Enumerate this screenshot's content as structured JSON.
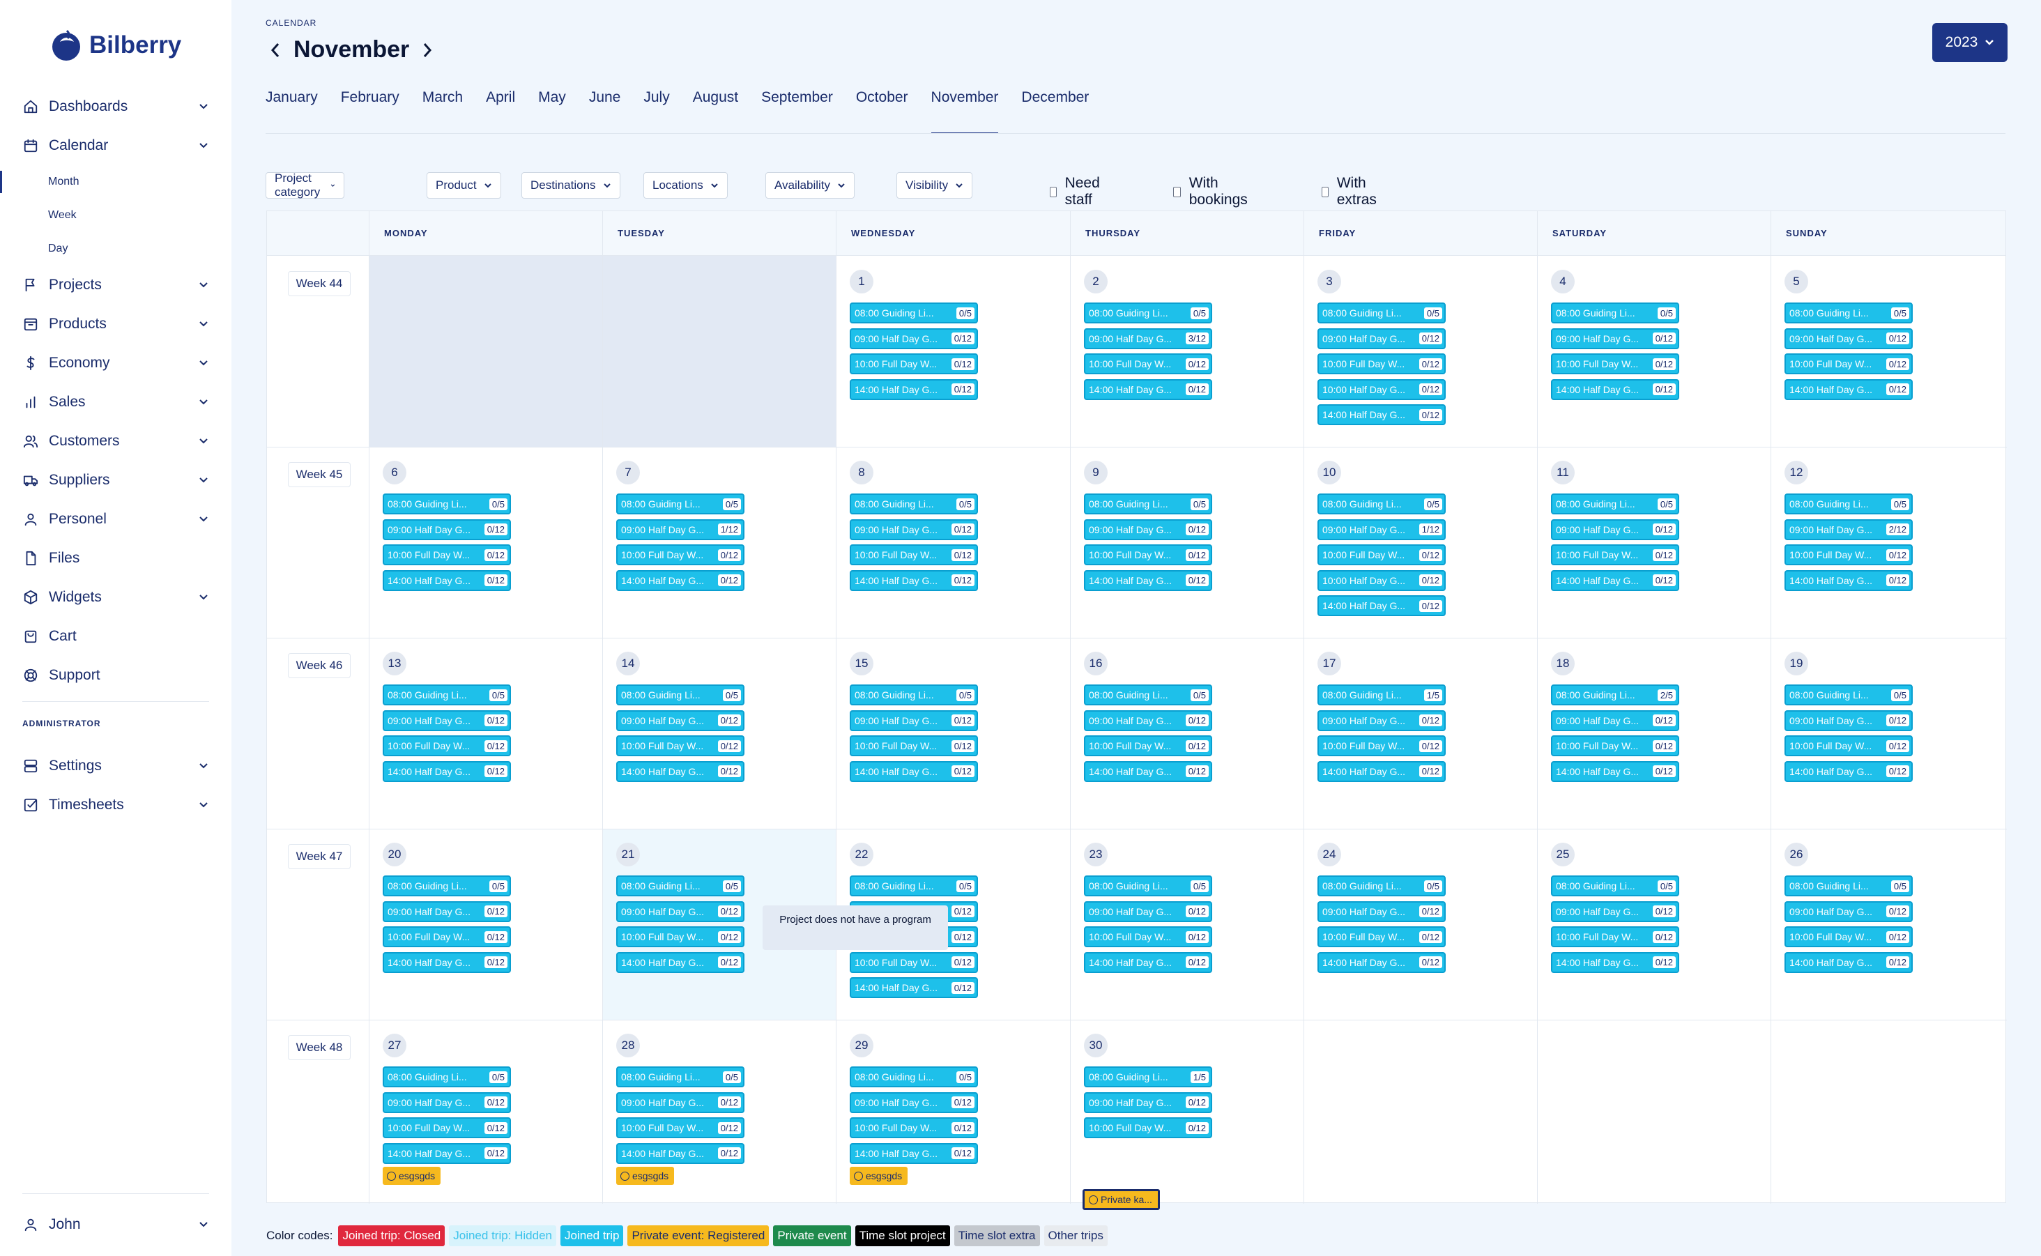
{
  "app": {
    "name": "Bilberry"
  },
  "sidebar": {
    "items": [
      {
        "label": "Dashboards",
        "icon": "home-icon",
        "chevron": true
      },
      {
        "label": "Calendar",
        "icon": "calendar-icon",
        "chevron": true
      },
      {
        "label": "Projects",
        "icon": "flag-icon",
        "chevron": true
      },
      {
        "label": "Products",
        "icon": "archive-icon",
        "chevron": true
      },
      {
        "label": "Economy",
        "icon": "dollar-icon",
        "chevron": true
      },
      {
        "label": "Sales",
        "icon": "bar-chart-icon",
        "chevron": true
      },
      {
        "label": "Customers",
        "icon": "users-icon",
        "chevron": true
      },
      {
        "label": "Suppliers",
        "icon": "truck-icon",
        "chevron": true
      },
      {
        "label": "Personel",
        "icon": "user-icon",
        "chevron": true
      },
      {
        "label": "Files",
        "icon": "file-icon",
        "chevron": false
      },
      {
        "label": "Widgets",
        "icon": "cube-icon",
        "chevron": true
      },
      {
        "label": "Cart",
        "icon": "cart-icon",
        "chevron": false
      },
      {
        "label": "Support",
        "icon": "lifebuoy-icon",
        "chevron": false
      }
    ],
    "calendar_sub": [
      "Month",
      "Week",
      "Day"
    ],
    "admin_label": "ADMINISTRATOR",
    "admin_items": [
      {
        "label": "Settings",
        "icon": "database-icon",
        "chevron": true
      },
      {
        "label": "Timesheets",
        "icon": "checkbox-icon",
        "chevron": true
      }
    ],
    "user": {
      "label": "John",
      "icon": "user-icon"
    }
  },
  "header": {
    "section_label": "CALENDAR",
    "title": "November",
    "year": "2023"
  },
  "months": [
    "January",
    "February",
    "March",
    "April",
    "May",
    "June",
    "July",
    "August",
    "September",
    "October",
    "November",
    "December"
  ],
  "active_month": "November",
  "filters": [
    "Project category",
    "Product",
    "Destinations",
    "Locations",
    "Availability",
    "Visibility"
  ],
  "checks": [
    "Need staff",
    "With bookings",
    "With extras"
  ],
  "weekdays": [
    "MONDAY",
    "TUESDAY",
    "WEDNESDAY",
    "THURSDAY",
    "FRIDAY",
    "SATURDAY",
    "SUNDAY"
  ],
  "weeks": [
    {
      "label": "Week 44",
      "days": [
        null,
        null,
        {
          "num": "1",
          "events": [
            [
              "08:00 Guiding Li...",
              "0/5"
            ],
            [
              "09:00 Half Day G...",
              "0/12"
            ],
            [
              "10:00 Full Day W...",
              "0/12"
            ],
            [
              "14:00 Half Day G...",
              "0/12"
            ]
          ]
        },
        {
          "num": "2",
          "events": [
            [
              "08:00 Guiding Li...",
              "0/5"
            ],
            [
              "09:00 Half Day G...",
              "3/12"
            ],
            [
              "10:00 Full Day W...",
              "0/12"
            ],
            [
              "14:00 Half Day G...",
              "0/12"
            ]
          ]
        },
        {
          "num": "3",
          "events": [
            [
              "08:00 Guiding Li...",
              "0/5"
            ],
            [
              "09:00 Half Day G...",
              "0/12"
            ],
            [
              "10:00 Full Day W...",
              "0/12"
            ],
            [
              "10:00 Half Day G...",
              "0/12"
            ],
            [
              "14:00 Half Day G...",
              "0/12"
            ]
          ]
        },
        {
          "num": "4",
          "events": [
            [
              "08:00 Guiding Li...",
              "0/5"
            ],
            [
              "09:00 Half Day G...",
              "0/12"
            ],
            [
              "10:00 Full Day W...",
              "0/12"
            ],
            [
              "14:00 Half Day G...",
              "0/12"
            ]
          ]
        },
        {
          "num": "5",
          "events": [
            [
              "08:00 Guiding Li...",
              "0/5"
            ],
            [
              "09:00 Half Day G...",
              "0/12"
            ],
            [
              "10:00 Full Day W...",
              "0/12"
            ],
            [
              "14:00 Half Day G...",
              "0/12"
            ]
          ]
        }
      ]
    },
    {
      "label": "Week 45",
      "days": [
        {
          "num": "6",
          "events": [
            [
              "08:00 Guiding Li...",
              "0/5"
            ],
            [
              "09:00 Half Day G...",
              "0/12"
            ],
            [
              "10:00 Full Day W...",
              "0/12"
            ],
            [
              "14:00 Half Day G...",
              "0/12"
            ]
          ]
        },
        {
          "num": "7",
          "events": [
            [
              "08:00 Guiding Li...",
              "0/5"
            ],
            [
              "09:00 Half Day G...",
              "1/12"
            ],
            [
              "10:00 Full Day W...",
              "0/12"
            ],
            [
              "14:00 Half Day G...",
              "0/12"
            ]
          ]
        },
        {
          "num": "8",
          "events": [
            [
              "08:00 Guiding Li...",
              "0/5"
            ],
            [
              "09:00 Half Day G...",
              "0/12"
            ],
            [
              "10:00 Full Day W...",
              "0/12"
            ],
            [
              "14:00 Half Day G...",
              "0/12"
            ]
          ]
        },
        {
          "num": "9",
          "events": [
            [
              "08:00 Guiding Li...",
              "0/5"
            ],
            [
              "09:00 Half Day G...",
              "0/12"
            ],
            [
              "10:00 Full Day W...",
              "0/12"
            ],
            [
              "14:00 Half Day G...",
              "0/12"
            ]
          ]
        },
        {
          "num": "10",
          "events": [
            [
              "08:00 Guiding Li...",
              "0/5"
            ],
            [
              "09:00 Half Day G...",
              "1/12"
            ],
            [
              "10:00 Full Day W...",
              "0/12"
            ],
            [
              "10:00 Half Day G...",
              "0/12"
            ],
            [
              "14:00 Half Day G...",
              "0/12"
            ]
          ]
        },
        {
          "num": "11",
          "events": [
            [
              "08:00 Guiding Li...",
              "0/5"
            ],
            [
              "09:00 Half Day G...",
              "0/12"
            ],
            [
              "10:00 Full Day W...",
              "0/12"
            ],
            [
              "14:00 Half Day G...",
              "0/12"
            ]
          ]
        },
        {
          "num": "12",
          "events": [
            [
              "08:00 Guiding Li...",
              "0/5"
            ],
            [
              "09:00 Half Day G...",
              "2/12"
            ],
            [
              "10:00 Full Day W...",
              "0/12"
            ],
            [
              "14:00 Half Day G...",
              "0/12"
            ]
          ]
        }
      ]
    },
    {
      "label": "Week 46",
      "days": [
        {
          "num": "13",
          "events": [
            [
              "08:00 Guiding Li...",
              "0/5"
            ],
            [
              "09:00 Half Day G...",
              "0/12"
            ],
            [
              "10:00 Full Day W...",
              "0/12"
            ],
            [
              "14:00 Half Day G...",
              "0/12"
            ]
          ]
        },
        {
          "num": "14",
          "events": [
            [
              "08:00 Guiding Li...",
              "0/5"
            ],
            [
              "09:00 Half Day G...",
              "0/12"
            ],
            [
              "10:00 Full Day W...",
              "0/12"
            ],
            [
              "14:00 Half Day G...",
              "0/12"
            ]
          ]
        },
        {
          "num": "15",
          "events": [
            [
              "08:00 Guiding Li...",
              "0/5"
            ],
            [
              "09:00 Half Day G...",
              "0/12"
            ],
            [
              "10:00 Full Day W...",
              "0/12"
            ],
            [
              "14:00 Half Day G...",
              "0/12"
            ]
          ]
        },
        {
          "num": "16",
          "events": [
            [
              "08:00 Guiding Li...",
              "0/5"
            ],
            [
              "09:00 Half Day G...",
              "0/12"
            ],
            [
              "10:00 Full Day W...",
              "0/12"
            ],
            [
              "14:00 Half Day G...",
              "0/12"
            ]
          ]
        },
        {
          "num": "17",
          "events": [
            [
              "08:00 Guiding Li...",
              "1/5"
            ],
            [
              "09:00 Half Day G...",
              "0/12"
            ],
            [
              "10:00 Full Day W...",
              "0/12"
            ],
            [
              "14:00 Half Day G...",
              "0/12"
            ]
          ]
        },
        {
          "num": "18",
          "events": [
            [
              "08:00 Guiding Li...",
              "2/5"
            ],
            [
              "09:00 Half Day G...",
              "0/12"
            ],
            [
              "10:00 Full Day W...",
              "0/12"
            ],
            [
              "14:00 Half Day G...",
              "0/12"
            ]
          ]
        },
        {
          "num": "19",
          "events": [
            [
              "08:00 Guiding Li...",
              "0/5"
            ],
            [
              "09:00 Half Day G...",
              "0/12"
            ],
            [
              "10:00 Full Day W...",
              "0/12"
            ],
            [
              "14:00 Half Day G...",
              "0/12"
            ]
          ]
        }
      ]
    },
    {
      "label": "Week 47",
      "days": [
        {
          "num": "20",
          "events": [
            [
              "08:00 Guiding Li...",
              "0/5"
            ],
            [
              "09:00 Half Day G...",
              "0/12"
            ],
            [
              "10:00 Full Day W...",
              "0/12"
            ],
            [
              "14:00 Half Day G...",
              "0/12"
            ]
          ]
        },
        {
          "num": "21",
          "today": true,
          "events": [
            [
              "08:00 Guiding Li...",
              "0/5"
            ],
            [
              "09:00 Half Day G...",
              "0/12"
            ],
            [
              "10:00 Full Day W...",
              "0/12"
            ],
            [
              "14:00 Half Day G...",
              "0/12"
            ]
          ]
        },
        {
          "num": "22",
          "events": [
            [
              "08:00 Guiding Li...",
              "0/5"
            ],
            [
              "09:00 Half Day G...",
              "0/12"
            ],
            [
              "09:00 Half Day G...",
              "0/12"
            ],
            [
              "10:00 Full Day W...",
              "0/12"
            ],
            [
              "14:00 Half Day G...",
              "0/12"
            ]
          ]
        },
        {
          "num": "23",
          "events": [
            [
              "08:00 Guiding Li...",
              "0/5"
            ],
            [
              "09:00 Half Day G...",
              "0/12"
            ],
            [
              "10:00 Full Day W...",
              "0/12"
            ],
            [
              "14:00 Half Day G...",
              "0/12"
            ]
          ]
        },
        {
          "num": "24",
          "events": [
            [
              "08:00 Guiding Li...",
              "0/5"
            ],
            [
              "09:00 Half Day G...",
              "0/12"
            ],
            [
              "10:00 Full Day W...",
              "0/12"
            ],
            [
              "14:00 Half Day G...",
              "0/12"
            ]
          ]
        },
        {
          "num": "25",
          "events": [
            [
              "08:00 Guiding Li...",
              "0/5"
            ],
            [
              "09:00 Half Day G...",
              "0/12"
            ],
            [
              "10:00 Full Day W...",
              "0/12"
            ],
            [
              "14:00 Half Day G...",
              "0/12"
            ]
          ]
        },
        {
          "num": "26",
          "events": [
            [
              "08:00 Guiding Li...",
              "0/5"
            ],
            [
              "09:00 Half Day G...",
              "0/12"
            ],
            [
              "10:00 Full Day W...",
              "0/12"
            ],
            [
              "14:00 Half Day G...",
              "0/12"
            ]
          ]
        }
      ]
    },
    {
      "label": "Week 48",
      "days": [
        {
          "num": "27",
          "events": [
            [
              "08:00 Guiding Li...",
              "0/5"
            ],
            [
              "09:00 Half Day G...",
              "0/12"
            ],
            [
              "10:00 Full Day W...",
              "0/12"
            ],
            [
              "14:00 Half Day G...",
              "0/12"
            ]
          ],
          "private": "esgsgds"
        },
        {
          "num": "28",
          "events": [
            [
              "08:00 Guiding Li...",
              "0/5"
            ],
            [
              "09:00 Half Day G...",
              "0/12"
            ],
            [
              "10:00 Full Day W...",
              "0/12"
            ],
            [
              "14:00 Half Day G...",
              "0/12"
            ]
          ],
          "private": "esgsgds"
        },
        {
          "num": "29",
          "events": [
            [
              "08:00 Guiding Li...",
              "0/5"
            ],
            [
              "09:00 Half Day G...",
              "0/12"
            ],
            [
              "10:00 Full Day W...",
              "0/12"
            ],
            [
              "14:00 Half Day G...",
              "0/12"
            ]
          ],
          "private": "esgsgds"
        },
        {
          "num": "30",
          "events": [
            [
              "08:00 Guiding Li...",
              "1/5"
            ],
            [
              "09:00 Half Day G...",
              "0/12"
            ],
            [
              "10:00 Full Day W...",
              "0/12"
            ]
          ],
          "private": "Private ka...",
          "private_selected": true
        },
        null,
        null,
        null
      ]
    }
  ],
  "tooltip": {
    "text": "Project does not have a program"
  },
  "legend": {
    "label": "Color codes:",
    "items": [
      {
        "label": "Joined trip: Closed",
        "bg": "#e0283d",
        "fg": "#ffffff"
      },
      {
        "label": "Joined trip: Hidden",
        "bg": "#d8f3fc",
        "fg": "#3bc2ea"
      },
      {
        "label": "Joined trip",
        "bg": "#1ec0ea",
        "fg": "#ffffff"
      },
      {
        "label": "Private event: Registered",
        "bg": "#f6b91e",
        "fg": "#1a2c6b"
      },
      {
        "label": "Private event",
        "bg": "#1e8a4c",
        "fg": "#ffffff"
      },
      {
        "label": "Time slot project",
        "bg": "#000000",
        "fg": "#ffffff"
      },
      {
        "label": "Time slot extra",
        "bg": "#c4c8ce",
        "fg": "#1a2c6b"
      },
      {
        "label": "Other trips",
        "bg": "#e8ebef",
        "fg": "#1a2c6b"
      }
    ]
  },
  "colors": {
    "brand": "#1d3587",
    "event": "#1ec0ea",
    "private": "#f6b91e"
  }
}
